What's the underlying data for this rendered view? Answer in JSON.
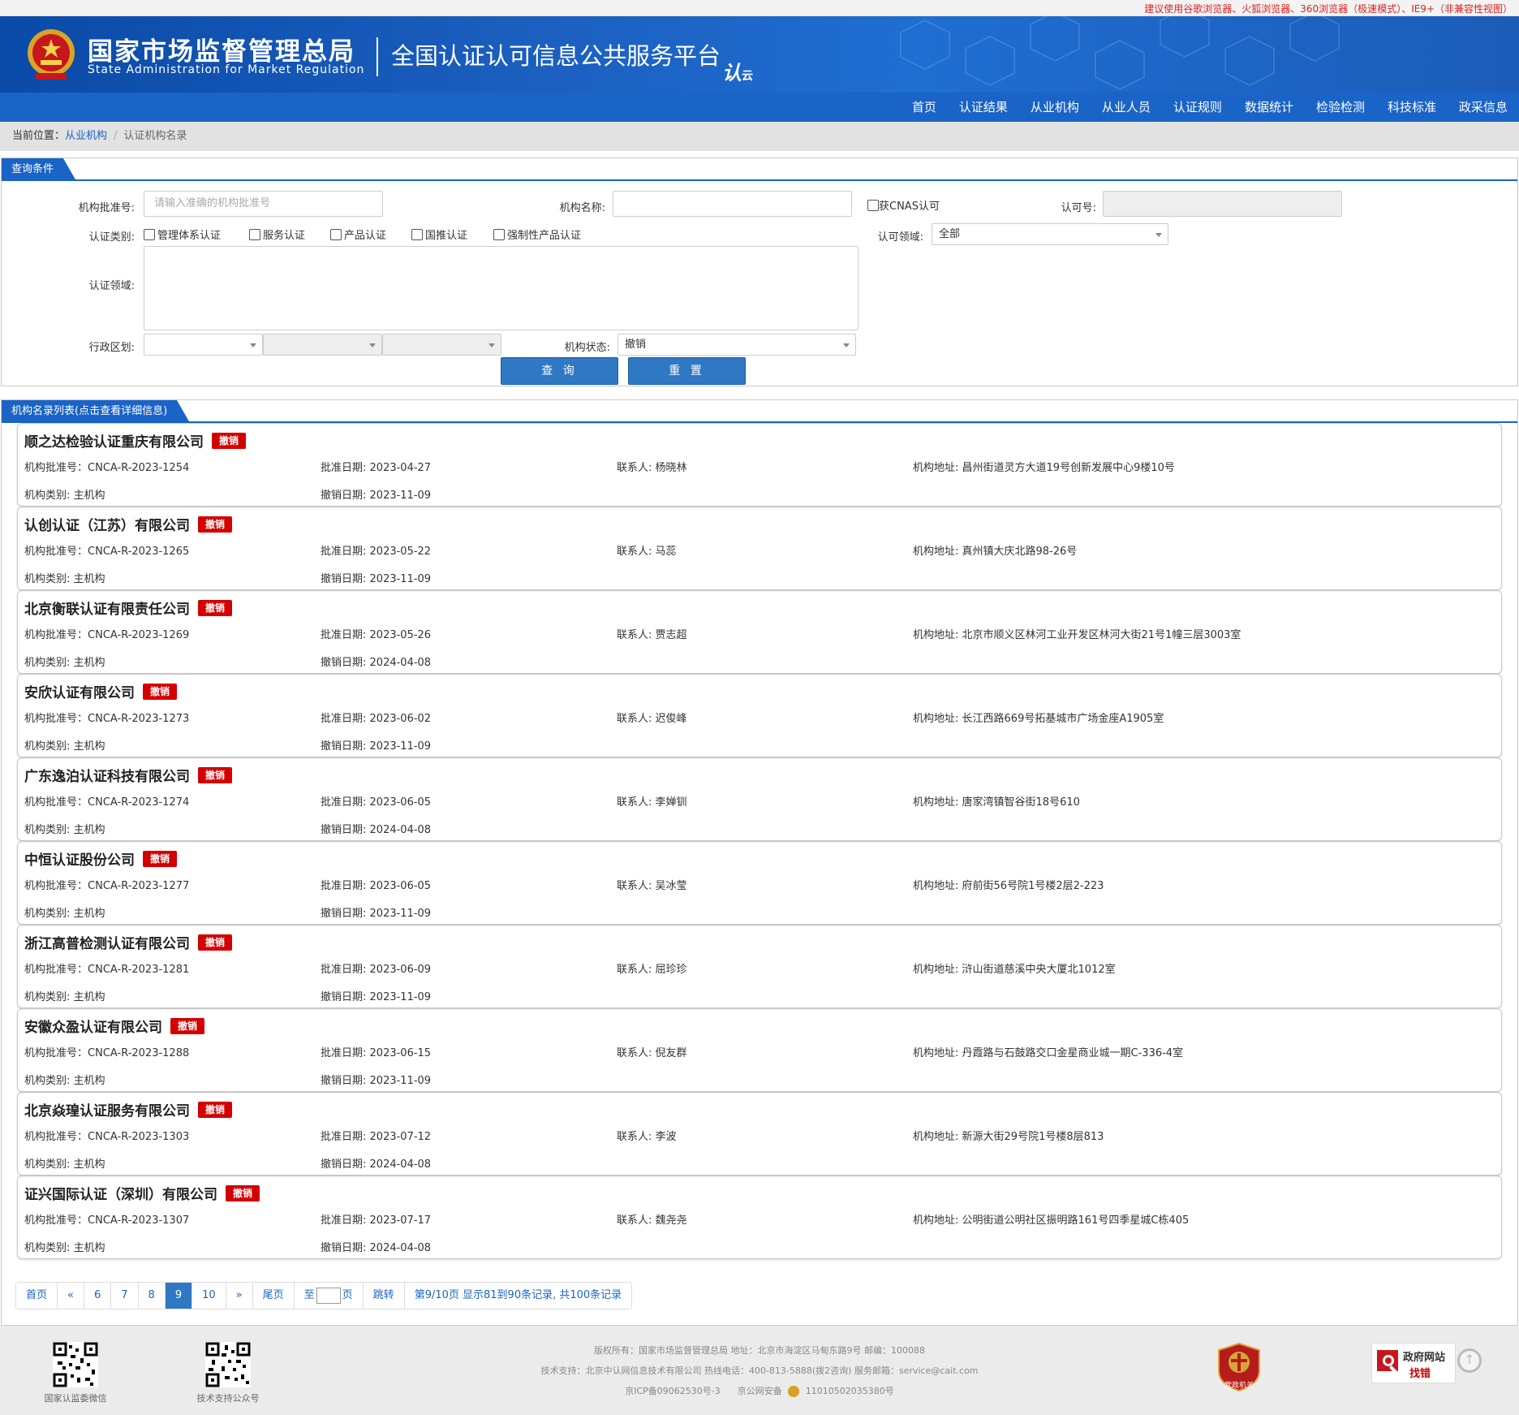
{
  "browser_notice": "建议使用谷歌浏览器、火狐浏览器、360浏览器（极速模式）、IE9+（非兼容性视图）",
  "header": {
    "org_cn": "国家市场监督管理总局",
    "org_en": "State Administration  for  Market Regulation",
    "platform": "全国认证认可信息公共服务平台",
    "logo_text": "认",
    "logo_suffix": "云"
  },
  "nav": [
    "首页",
    "认证结果",
    "从业机构",
    "从业人员",
    "认证规则",
    "数据统计",
    "检验检测",
    "科技标准",
    "政采信息"
  ],
  "breadcrumb": {
    "prefix": "当前位置：",
    "link": "从业机构",
    "sep": "/",
    "current": "认证机构名录"
  },
  "query": {
    "tab": "查询条件",
    "approval_no_label": "机构批准号:",
    "approval_no_placeholder": "请输入准确的机构批准号",
    "name_label": "机构名称:",
    "cnas_label": "获CNAS认可",
    "license_label": "认可号:",
    "category_label": "认证类别:",
    "categories": [
      "管理体系认证",
      "服务认证",
      "产品认证",
      "国推认证",
      "强制性产品认证"
    ],
    "accredit_field_label": "认可领域:",
    "accredit_field_value": "全部",
    "cert_field_label": "认证领域:",
    "region_label": "行政区划:",
    "status_label": "机构状态:",
    "status_value": "撤销",
    "search_btn": "查 询",
    "reset_btn": "重 置"
  },
  "list": {
    "tab": "机构名录列表(点击查看详细信息)",
    "labels": {
      "approval_no": "机构批准号：",
      "approval_date": "批准日期:",
      "contact": "联系人:",
      "address": "机构地址:",
      "type": "机构类别:",
      "revoke_date": "撤销日期:"
    },
    "badge": "撤销",
    "items": [
      {
        "name": "顺之达检验认证重庆有限公司",
        "no": "CNCA-R-2023-1254",
        "approve": "2023-04-27",
        "contact": "杨晓林",
        "address": "昌州街道灵方大道19号创新发展中心9楼10号",
        "type": "主机构",
        "revoke": "2023-11-09"
      },
      {
        "name": "认创认证（江苏）有限公司",
        "no": "CNCA-R-2023-1265",
        "approve": "2023-05-22",
        "contact": "马蕊",
        "address": "真州镇大庆北路98-26号",
        "type": "主机构",
        "revoke": "2023-11-09"
      },
      {
        "name": "北京衡联认证有限责任公司",
        "no": "CNCA-R-2023-1269",
        "approve": "2023-05-26",
        "contact": "贾志超",
        "address": "北京市顺义区林河工业开发区林河大街21号1幢三层3003室",
        "type": "主机构",
        "revoke": "2024-04-08"
      },
      {
        "name": "安欣认证有限公司",
        "no": "CNCA-R-2023-1273",
        "approve": "2023-06-02",
        "contact": "迟俊峰",
        "address": "长江西路669号拓基城市广场金座A1905室",
        "type": "主机构",
        "revoke": "2023-11-09"
      },
      {
        "name": "广东逸泊认证科技有限公司",
        "no": "CNCA-R-2023-1274",
        "approve": "2023-06-05",
        "contact": "李婵钏",
        "address": "唐家湾镇智谷街18号610",
        "type": "主机构",
        "revoke": "2024-04-08"
      },
      {
        "name": "中恒认证股份公司",
        "no": "CNCA-R-2023-1277",
        "approve": "2023-06-05",
        "contact": "吴冰莹",
        "address": "府前街56号院1号楼2层2-223",
        "type": "主机构",
        "revoke": "2023-11-09"
      },
      {
        "name": "浙江高普检测认证有限公司",
        "no": "CNCA-R-2023-1281",
        "approve": "2023-06-09",
        "contact": "屈珍珍",
        "address": "浒山街道慈溪中央大厦北1012室",
        "type": "主机构",
        "revoke": "2023-11-09"
      },
      {
        "name": "安徽众盈认证有限公司",
        "no": "CNCA-R-2023-1288",
        "approve": "2023-06-15",
        "contact": "倪友群",
        "address": "丹霞路与石鼓路交口金星商业城一期C-336-4室",
        "type": "主机构",
        "revoke": "2023-11-09"
      },
      {
        "name": "北京焱瑝认证服务有限公司",
        "no": "CNCA-R-2023-1303",
        "approve": "2023-07-12",
        "contact": "李波",
        "address": "新源大街29号院1号楼8层813",
        "type": "主机构",
        "revoke": "2024-04-08"
      },
      {
        "name": "证兴国际认证（深圳）有限公司",
        "no": "CNCA-R-2023-1307",
        "approve": "2023-07-17",
        "contact": "魏尧尧",
        "address": "公明街道公明社区振明路161号四季星城C栋405",
        "type": "主机构",
        "revoke": "2024-04-08"
      }
    ]
  },
  "pager": {
    "first": "首页",
    "prev": "«",
    "pages": [
      "6",
      "7",
      "8",
      "9",
      "10"
    ],
    "current": "9",
    "next": "»",
    "last": "尾页",
    "goto_prefix": "至",
    "goto_suffix": "页",
    "jump": "跳转",
    "summary": "第9/10页  显示81到90条记录, 共100条记录"
  },
  "footer": {
    "qr1_caption": "国家认监委微信",
    "qr2_caption": "技术支持公众号",
    "line1": "版权所有：国家市场监督管理总局    地址：北京市海淀区马甸东路9号    邮编：100088",
    "line2": "技术支持：北京中认网信息技术有限公司    热线电话：400-813-5888(拨2咨询)    服务邮箱：service@cait.com",
    "icp": "京ICP备09062530号-3",
    "police": "京公网安备",
    "police_no": "11010502035380号",
    "party_badge": "党政机关",
    "gov_t1": "政府网站",
    "gov_t2": "找错"
  },
  "colors": {
    "brand_blue": "#1a63c7",
    "badge_red": "#d40000",
    "notice_red": "#dd2222"
  }
}
